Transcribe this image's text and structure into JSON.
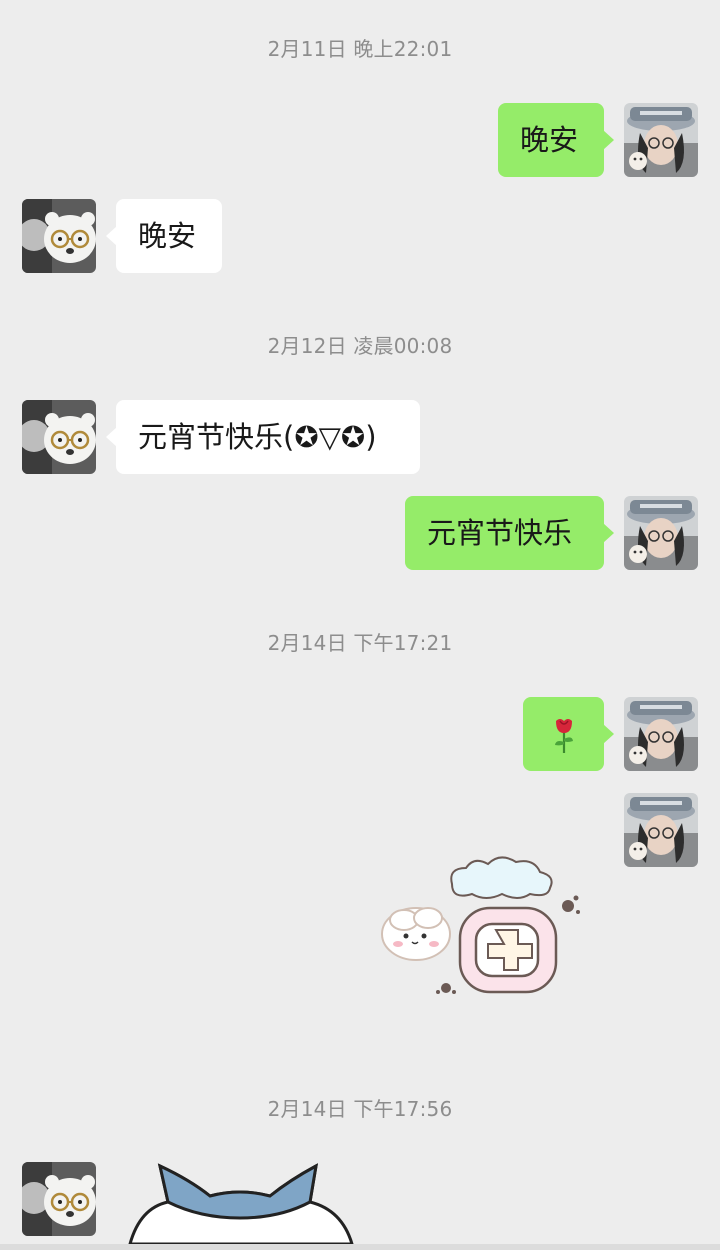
{
  "messages": {
    "ts1": "2月11日 晚上22:01",
    "m1_text": "晚安",
    "m2_text": "晚安",
    "ts2": "2月12日 凌晨00:08",
    "m3_text": "元宵节快乐(✪▽✪)",
    "m4_text": "元宵节快乐",
    "ts3": "2月14日 下午17:21",
    "m5_emoji": "rose-emoji",
    "m6_sticker": "cartoon-sticker-with-clouds",
    "ts4": "2月14日 下午17:56",
    "m7_sticker": "blue-cat-sticker"
  },
  "avatars": {
    "self": "avatar-person-with-hat-icon",
    "friend": "avatar-bear-with-glasses-icon"
  },
  "colors": {
    "background": "#ededed",
    "bubble_self": "#95ec69",
    "bubble_friend": "#ffffff",
    "timestamp": "#8d8d8d"
  }
}
